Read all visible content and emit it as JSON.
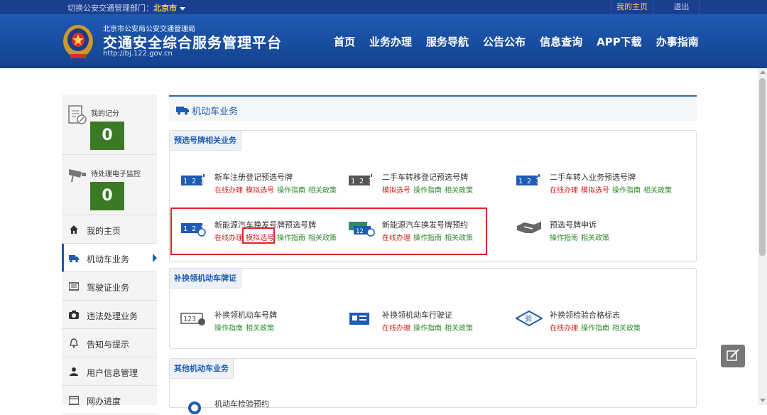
{
  "topbar": {
    "dept_prefix": "切换公安交通管理部门：",
    "dept_city": "北京市",
    "my_home": "我的主页",
    "logout": "退出"
  },
  "header": {
    "subtitle": "北京市公安局公安交通管理局",
    "title": "交通安全综合服务管理平台",
    "url": "http://bj.122.gov.cn"
  },
  "nav": [
    "首页",
    "业务办理",
    "服务导航",
    "公告公布",
    "信息查询",
    "APP下载",
    "办事指南"
  ],
  "sidebar": {
    "score_label": "我的记分",
    "score_value": "0",
    "monitor_label": "待处理电子监控",
    "monitor_value": "0",
    "items": [
      {
        "label": "我的主页",
        "icon": "home-icon"
      },
      {
        "label": "机动车业务",
        "icon": "truck-icon",
        "active": true
      },
      {
        "label": "驾驶证业务",
        "icon": "license-icon"
      },
      {
        "label": "违法处理业务",
        "icon": "camera-icon"
      },
      {
        "label": "告知与提示",
        "icon": "bell-icon"
      },
      {
        "label": "用户信息管理",
        "icon": "user-icon"
      },
      {
        "label": "网办进度",
        "icon": "progress-icon"
      }
    ]
  },
  "main": {
    "title": "机动车业务",
    "sections": [
      {
        "title": "预选号牌相关业务",
        "services": [
          {
            "name": "新车注册登记预选号牌",
            "links": [
              {
                "t": "在线办理",
                "c": "red"
              },
              {
                "t": "模拟选号",
                "c": "red"
              },
              {
                "t": "操作指南",
                "c": "green"
              },
              {
                "t": "相关政策",
                "c": "green"
              }
            ]
          },
          {
            "name": "二手车转移登记预选号牌",
            "links": [
              {
                "t": "模拟选号",
                "c": "red"
              },
              {
                "t": "操作指南",
                "c": "green"
              },
              {
                "t": "相关政策",
                "c": "green"
              }
            ]
          },
          {
            "name": "二手车转入业务预选号牌",
            "links": [
              {
                "t": "在线办理",
                "c": "red"
              },
              {
                "t": "模拟选号",
                "c": "red"
              },
              {
                "t": "操作指南",
                "c": "green"
              },
              {
                "t": "相关政策",
                "c": "green"
              }
            ]
          },
          {
            "name": "新能源汽车换发号牌预选号牌",
            "links": [
              {
                "t": "在线办理",
                "c": "red"
              },
              {
                "t": "模拟选号",
                "c": "red"
              },
              {
                "t": "操作指南",
                "c": "green"
              },
              {
                "t": "相关政策",
                "c": "green"
              }
            ]
          },
          {
            "name": "新能源汽车换发号牌预约",
            "links": [
              {
                "t": "在线办理",
                "c": "red"
              },
              {
                "t": "操作指南",
                "c": "green"
              },
              {
                "t": "相关政策",
                "c": "green"
              }
            ]
          },
          {
            "name": "预选号牌申诉",
            "links": [
              {
                "t": "操作指南",
                "c": "green"
              },
              {
                "t": "相关政策",
                "c": "green"
              }
            ]
          }
        ]
      },
      {
        "title": "补换领机动车牌证",
        "services": [
          {
            "name": "补换领机动车号牌",
            "links": [
              {
                "t": "操作指南",
                "c": "green"
              },
              {
                "t": "相关政策",
                "c": "green"
              }
            ]
          },
          {
            "name": "补换领机动车行驶证",
            "links": [
              {
                "t": "在线办理",
                "c": "red"
              },
              {
                "t": "操作指南",
                "c": "green"
              },
              {
                "t": "相关政策",
                "c": "green"
              }
            ]
          },
          {
            "name": "补换领检验合格标志",
            "links": [
              {
                "t": "在线办理",
                "c": "red"
              },
              {
                "t": "操作指南",
                "c": "green"
              },
              {
                "t": "相关政策",
                "c": "green"
              }
            ]
          }
        ]
      },
      {
        "title": "其他机动车业务",
        "services": [
          {
            "name": "机动车检验预约",
            "links": []
          }
        ]
      }
    ]
  }
}
